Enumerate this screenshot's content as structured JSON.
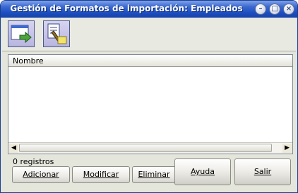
{
  "window": {
    "title": "Gestión de Formatos de importación: Empleados"
  },
  "toolbar": [
    {
      "name": "import-icon"
    },
    {
      "name": "edit-format-icon"
    }
  ],
  "grid": {
    "columns": [
      "Nombre"
    ],
    "rows": []
  },
  "status": {
    "count_label": "0 registros"
  },
  "buttons": {
    "add": "Adicionar",
    "modify": "Modificar",
    "delete": "Eliminar",
    "help": "Ayuda",
    "exit": "Salir"
  }
}
